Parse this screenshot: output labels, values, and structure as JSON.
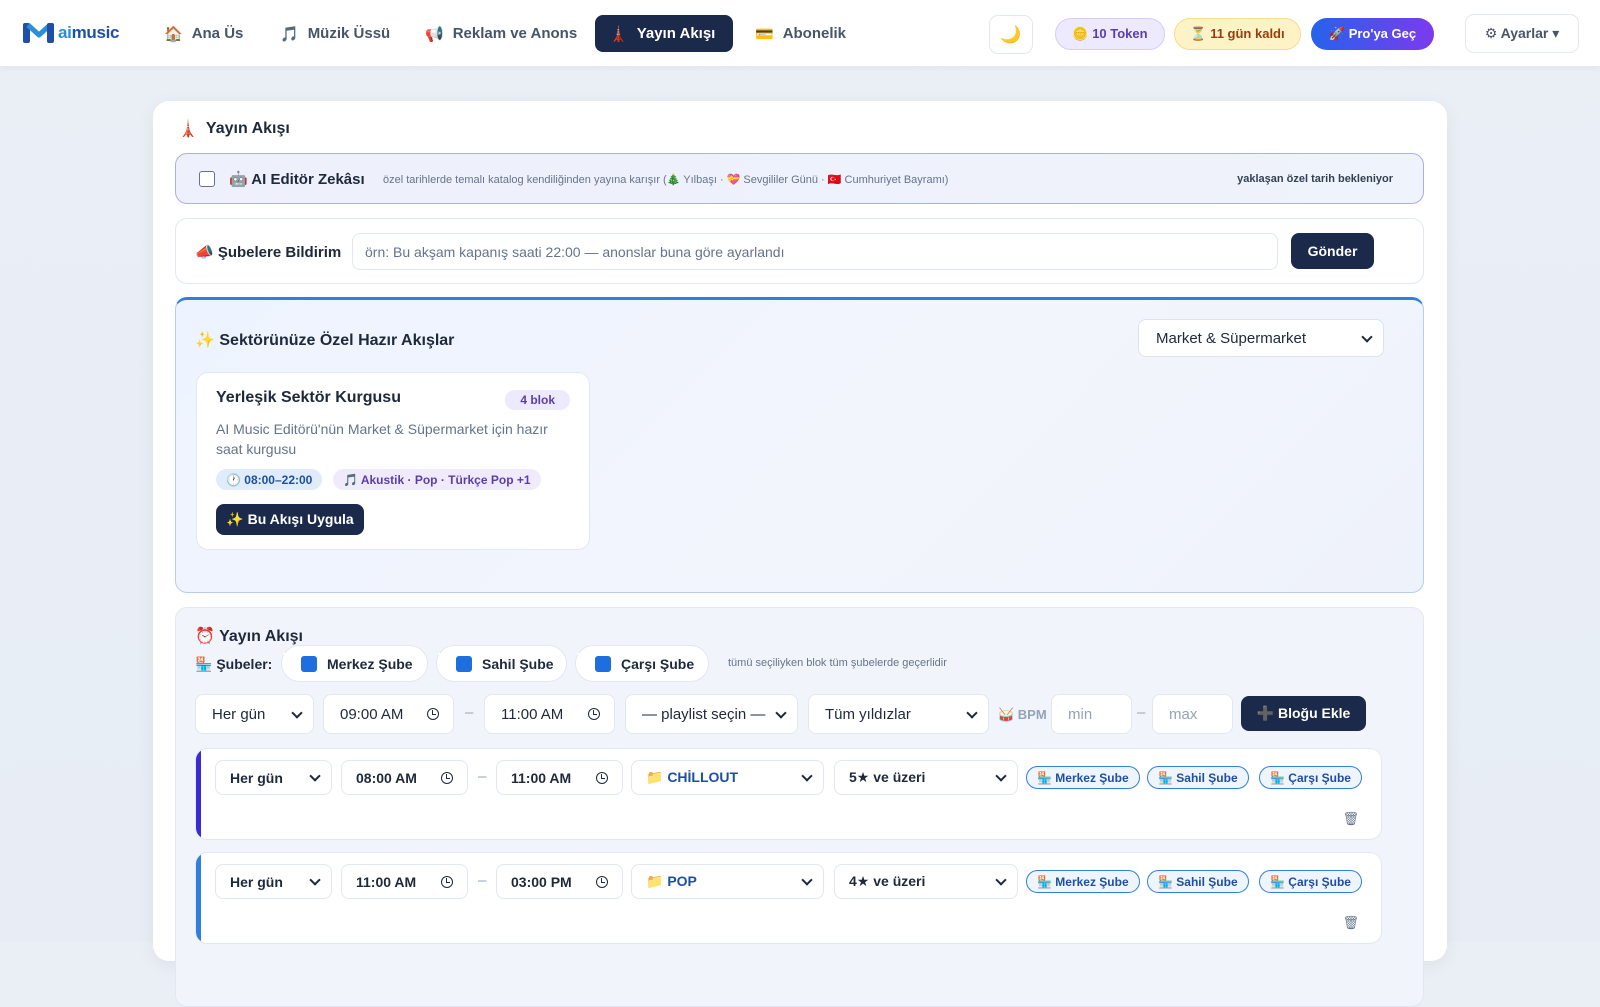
{
  "nav": {
    "logo_ai": "ai",
    "logo_music": "music",
    "items": [
      {
        "icon": "🏠",
        "label": "Ana Üs"
      },
      {
        "icon": "🎵",
        "label": "Müzik Üssü"
      },
      {
        "icon": "📢",
        "label": "Reklam ve Anons"
      },
      {
        "icon": "🗼",
        "label": "Yayın Akışı"
      },
      {
        "icon": "💳",
        "label": "Abonelik"
      }
    ],
    "theme_icon": "🌙",
    "token_label": "🪙 10 Token",
    "days_label": "⏳ 11 gün kaldı",
    "pro_label": "🚀 Pro'ya Geç",
    "settings_label": "⚙ Ayarlar ▾"
  },
  "page": {
    "title_icon": "🗼",
    "title": "Yayın Akışı"
  },
  "ai_editor": {
    "label": "🤖 AI Editör Zekâsı",
    "description": "özel tarihlerde temalı katalog kendiliğinden yayına karışır (🎄 Yılbaşı · 💝 Sevgililer Günü · 🇹🇷 Cumhuriyet Bayramı)",
    "status": "yaklaşan özel tarih bekleniyor",
    "checked": false
  },
  "notify": {
    "label": "📣 Şubelere Bildirim",
    "placeholder": "örn: Bu akşam kapanış saati 22:00 — anonslar buna göre ayarlandı",
    "send_label": "Gönder"
  },
  "sector": {
    "title": "✨ Sektörünüze Özel Hazır Akışlar",
    "selected": "Market & Süpermarket",
    "card": {
      "title": "Yerleşik Sektör Kurgusu",
      "badge": "4 blok",
      "description": "AI Music Editörü'nün Market & Süpermarket için hazır saat kurgusu",
      "time_chip": "🕐 08:00–22:00",
      "genre_chip": "🎵 Akustik · Pop · Türkçe Pop +1",
      "apply_label": "✨ Bu Akışı Uygula"
    }
  },
  "schedule": {
    "title": "⏰ Yayın Akışı",
    "branches_label": "🏪 Şubeler:",
    "branches": [
      "Merkez Şube",
      "Sahil Şube",
      "Çarşı Şube"
    ],
    "branch_note": "tümü seçiliyken blok tüm şubelerde geçerlidir",
    "form": {
      "day": "Her gün",
      "start": "09:00 AM",
      "end": "11:00 AM",
      "playlist": "— playlist seçin —",
      "rating": "Tüm yıldızlar",
      "bpm_label": "🥁 BPM",
      "bpm_min_placeholder": "min",
      "bpm_max_placeholder": "max",
      "add_label": "➕ Bloğu Ekle"
    },
    "blocks": [
      {
        "day": "Her gün",
        "start": "08:00 AM",
        "end": "11:00 AM",
        "playlist": "📁 CHİLLOUT",
        "rating": "5★ ve üzeri",
        "branches": [
          "🏪 Merkez Şube",
          "🏪 Sahil Şube",
          "🏪 Çarşı Şube"
        ],
        "accent": "#3b2bd6"
      },
      {
        "day": "Her gün",
        "start": "11:00 AM",
        "end": "03:00 PM",
        "playlist": "📁 POP",
        "rating": "4★ ve üzeri",
        "branches": [
          "🏪 Merkez Şube",
          "🏪 Sahil Şube",
          "🏪 Çarşı Şube"
        ],
        "accent": "#2f7fde"
      }
    ],
    "trash_icon": "🗑"
  }
}
